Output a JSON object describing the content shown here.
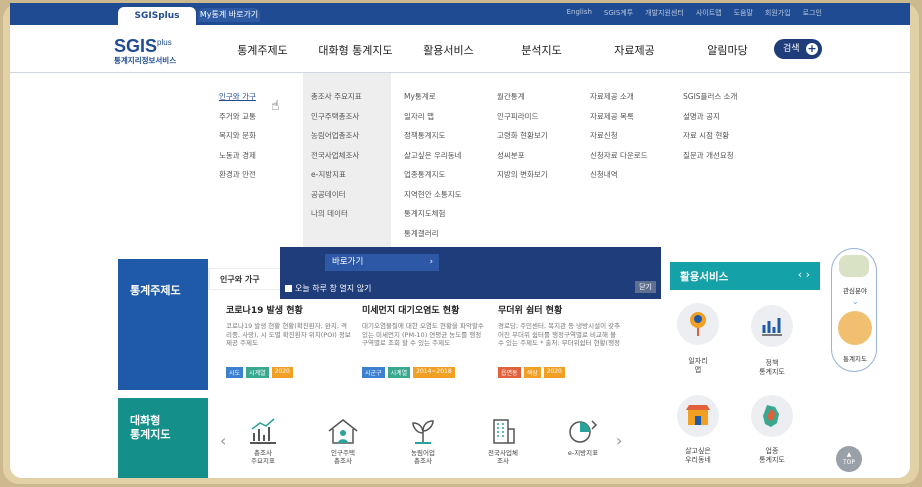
{
  "topbar": {
    "tab_sgis": "SGISplus",
    "tab_my": "My통계 바로가기",
    "links": [
      "English",
      "SGIS계투",
      "개발지원센터",
      "사이트맵",
      "도움말",
      "회원가입",
      "로그인"
    ]
  },
  "logo": {
    "main": "SGIS",
    "plus": "plus",
    "sub": "통계지리정보서비스"
  },
  "gnb": [
    "통계주제도",
    "대화형 통계지도",
    "활용서비스",
    "분석지도",
    "자료제공",
    "알림마당"
  ],
  "search_label": "검색",
  "mega": {
    "col1": [
      "인구와 가구",
      "주거와 교통",
      "복지와 문화",
      "노동과 경제",
      "환경과 안전"
    ],
    "col2": [
      "총조사 주요지표",
      "인구주택총조사",
      "농림어업총조사",
      "전국사업체조사",
      "e-지방지표",
      "공공데이터",
      "나의 데이터"
    ],
    "col3": [
      "My통계로",
      "일자리 맵",
      "정책통계지도",
      "살고싶은 우리동네",
      "업종통계지도",
      "지역현안 소통지도",
      "통계지도체험",
      "통계갤러리"
    ],
    "col4": [
      "월간통계",
      "인구피라미드",
      "고령화 현황보기",
      "성씨분포",
      "지방의 변화보기"
    ],
    "col5": [
      "자료제공 소개",
      "자료제공 목록",
      "자료신청",
      "신청자료 다운로드",
      "신청내역"
    ],
    "col6": [
      "SGIS플러스 소개",
      "설명과 공지",
      "자료 시점 현황",
      "질문과 개선요청"
    ]
  },
  "popup": {
    "go": "바로가기",
    "dont_show": "오늘 하루 창 열지 않기",
    "close": "닫기"
  },
  "theme_box": "통계주제도",
  "theme_tab": "인구와 가구",
  "interactive_box": "대화형\n통계지도",
  "cards": [
    {
      "title": "코로나19 발생 현황",
      "desc": "코로나19 발생 현황 현황(확진환자, 완치, 격리중, 사망), 시 도별 확진환자 위치(POI) 정보 제공 주제도",
      "tags": [
        "시도",
        "시계열",
        "2020"
      ]
    },
    {
      "title": "미세먼지 대기오염도 현황",
      "desc": "대기오염물질에 대한 오염도 현황을 파악할수 있는 미세먼지 (PM-10) 연평균 농도를 행정구역별로 조회 할 수 있는 주제도",
      "tags": [
        "시군구",
        "시계열",
        "2014~2018"
      ]
    },
    {
      "title": "무더위 쉼터 현황",
      "desc": "경로당, 주민센터, 복지관 등 냉방시설이 갖추어진 무더위 쉼터를 행정구역별로 비교해 볼 수 있는 주제도 * 출처: 무더위쉼터 현황(행정",
      "tags": [
        "읍면동",
        "색상",
        "2020"
      ]
    }
  ],
  "icons": [
    {
      "label": "총조사\n주요지표",
      "icon": "bar-chart-icon"
    },
    {
      "label": "인구주택\n총조사",
      "icon": "house-icon"
    },
    {
      "label": "농림어업\n총조사",
      "icon": "leaf-icon"
    },
    {
      "label": "전국사업체\n조사",
      "icon": "building-icon"
    },
    {
      "label": "e-지방지표",
      "icon": "pie-chart-icon"
    }
  ],
  "activity": {
    "title": "활용서비스",
    "items": [
      "일자리\n맵",
      "정책\n통계지도",
      "살고싶은\n우리동네",
      "업종\n통계지도"
    ]
  },
  "rpanel": {
    "item1": "관심분야",
    "item2": "통계지도"
  },
  "top_label": "TOP"
}
